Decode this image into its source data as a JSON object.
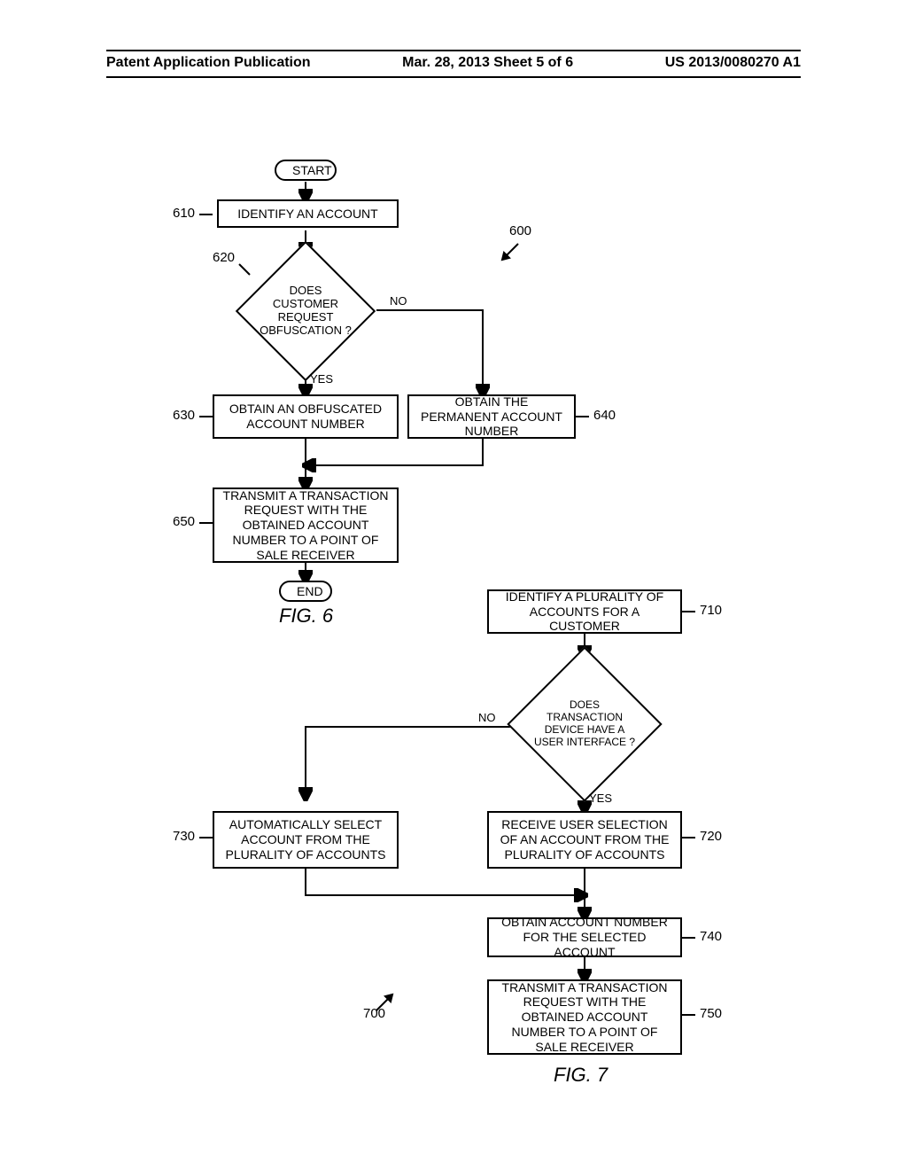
{
  "header": {
    "left": "Patent Application Publication",
    "center": "Mar. 28, 2013  Sheet 5 of 6",
    "right": "US 2013/0080270 A1"
  },
  "fig6": {
    "start": "START",
    "end": "END",
    "caption": "FIG. 6",
    "ref600": "600",
    "ref610": "610",
    "ref620": "620",
    "ref630": "630",
    "ref640": "640",
    "ref650": "650",
    "yes": "YES",
    "no": "NO",
    "b610": "IDENTIFY AN ACCOUNT",
    "d620": "DOES CUSTOMER REQUEST OBFUSCATION ?",
    "b630": "OBTAIN AN OBFUSCATED ACCOUNT NUMBER",
    "b640": "OBTAIN THE PERMANENT ACCOUNT NUMBER",
    "b650": "TRANSMIT A TRANSACTION REQUEST WITH THE OBTAINED ACCOUNT NUMBER TO A POINT OF SALE RECEIVER"
  },
  "fig7": {
    "caption": "FIG. 7",
    "ref700": "700",
    "ref710": "710",
    "ref720": "720",
    "ref730": "730",
    "ref740": "740",
    "ref750": "750",
    "yes": "YES",
    "no": "NO",
    "b710": "IDENTIFY A PLURALITY OF ACCOUNTS FOR A CUSTOMER",
    "d715": "DOES TRANSACTION DEVICE HAVE A USER INTERFACE ?",
    "b720": "RECEIVE USER SELECTION OF AN ACCOUNT FROM THE PLURALITY OF ACCOUNTS",
    "b730": "AUTOMATICALLY SELECT ACCOUNT FROM THE PLURALITY OF ACCOUNTS",
    "b740": "OBTAIN ACCOUNT NUMBER FOR THE SELECTED ACCOUNT",
    "b750": "TRANSMIT A TRANSACTION REQUEST WITH THE OBTAINED ACCOUNT NUMBER TO A POINT OF SALE RECEIVER"
  }
}
